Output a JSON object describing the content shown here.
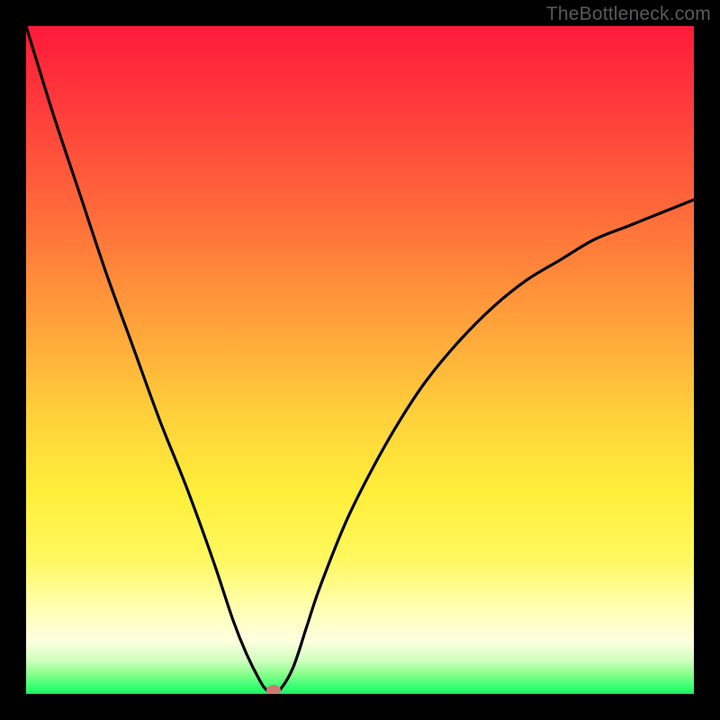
{
  "watermark": "TheBottleneck.com",
  "chart_data": {
    "type": "line",
    "title": "",
    "xlabel": "",
    "ylabel": "",
    "xlim": [
      0,
      100
    ],
    "ylim": [
      0,
      100
    ],
    "grid": false,
    "legend": null,
    "series": [
      {
        "name": "bottleneck-curve",
        "x": [
          0,
          4,
          8,
          12,
          16,
          20,
          24,
          28,
          31,
          33,
          35,
          36,
          37,
          38,
          40,
          42,
          44,
          48,
          52,
          56,
          60,
          65,
          70,
          75,
          80,
          85,
          90,
          95,
          100
        ],
        "y": [
          100,
          87,
          75,
          63,
          52,
          41,
          31,
          20,
          11,
          6,
          2,
          0.6,
          0.4,
          0.6,
          4,
          10,
          16,
          26,
          34,
          41,
          47,
          53,
          58,
          62,
          65,
          68,
          70,
          72,
          74
        ]
      }
    ],
    "marker": {
      "x": 37,
      "y": 0.5,
      "color": "#cf7a6f"
    },
    "gradient_colors": {
      "top": "#ff1a3a",
      "mid": "#ffd03a",
      "bottom": "#20e865"
    },
    "frame_color": "#000000"
  }
}
